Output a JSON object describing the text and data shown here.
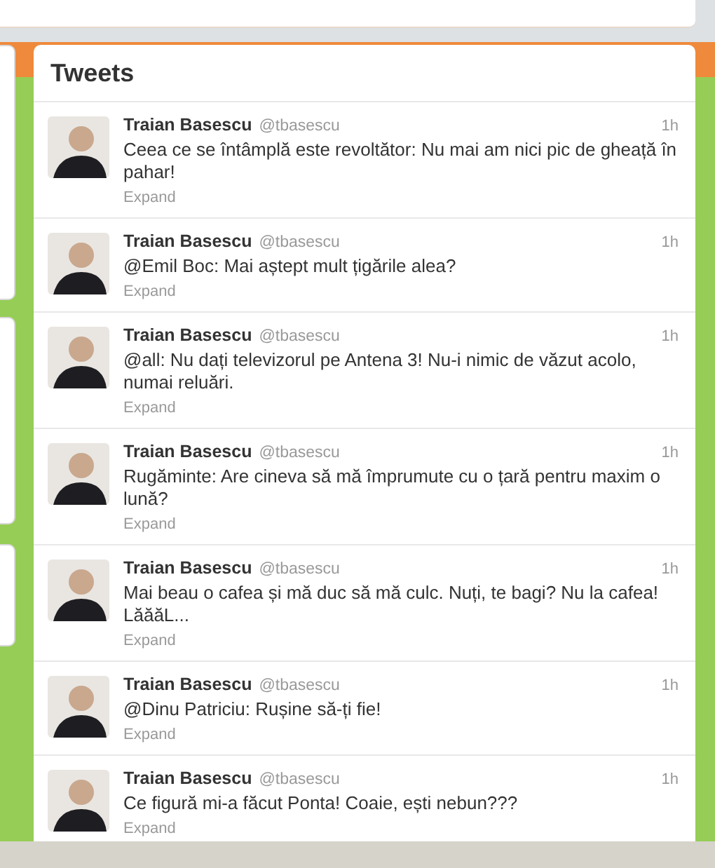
{
  "timeline": {
    "title": "Tweets",
    "tweets": [
      {
        "name": "Traian Basescu",
        "handle": "@tbasescu",
        "time": "1h",
        "text": "Ceea ce se întâmplă este revoltător: Nu mai am nici pic de gheață în pahar!",
        "action": "Expand"
      },
      {
        "name": "Traian Basescu",
        "handle": "@tbasescu",
        "time": "1h",
        "text": "@Emil Boc: Mai aștept mult țigările alea?",
        "action": "Expand"
      },
      {
        "name": "Traian Basescu",
        "handle": "@tbasescu",
        "time": "1h",
        "text": "@all: Nu dați televizorul pe Antena 3! Nu-i nimic de văzut acolo, numai reluări.",
        "action": "Expand"
      },
      {
        "name": "Traian Basescu",
        "handle": "@tbasescu",
        "time": "1h",
        "text": "Rugăminte: Are cineva să mă împrumute cu o țară pentru maxim o lună?",
        "action": "Expand"
      },
      {
        "name": "Traian Basescu",
        "handle": "@tbasescu",
        "time": "1h",
        "text": "Mai beau o cafea și mă duc să mă culc. Nuți, te bagi? Nu la cafea! LăăăL...",
        "action": "Expand"
      },
      {
        "name": "Traian Basescu",
        "handle": "@tbasescu",
        "time": "1h",
        "text": "@Dinu Patriciu: Rușine să-ți fie!",
        "action": "Expand"
      },
      {
        "name": "Traian Basescu",
        "handle": "@tbasescu",
        "time": "1h",
        "text": "Ce figură mi-a făcut Ponta! Coaie, ești nebun???",
        "action": "Expand"
      }
    ]
  }
}
